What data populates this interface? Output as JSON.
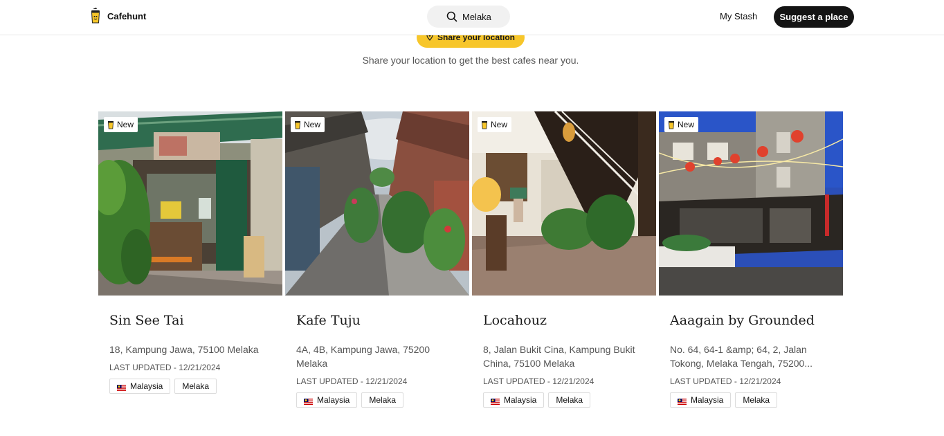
{
  "header": {
    "brand_name": "Cafehunt",
    "search_value": "Melaka",
    "my_stash_label": "My Stash",
    "suggest_label": "Suggest a place"
  },
  "location": {
    "button_label": "Share your location",
    "hint": "Share your location to get the best cafes near you."
  },
  "cafes": [
    {
      "badge": "New",
      "name": "Sin See Tai",
      "address": "18, Kampung Jawa, 75100 Melaka",
      "updated": "LAST UPDATED - 12/21/2024",
      "country": "Malaysia",
      "city": "Melaka"
    },
    {
      "badge": "New",
      "name": "Kafe Tuju",
      "address": "4A, 4B, Kampung Jawa, 75200 Melaka",
      "updated": "LAST UPDATED - 12/21/2024",
      "country": "Malaysia",
      "city": "Melaka"
    },
    {
      "badge": "New",
      "name": "Locahouz",
      "address": "8, Jalan Bukit Cina, Kampung Bukit China, 75100 Melaka",
      "updated": "LAST UPDATED - 12/21/2024",
      "country": "Malaysia",
      "city": "Melaka"
    },
    {
      "badge": "New",
      "name": "Aaagain by Grounded",
      "address": "No. 64, 64-1 &amp; 64, 2, Jalan Tokong, Melaka Tengah, 75200...",
      "updated": "LAST UPDATED - 12/21/2024",
      "country": "Malaysia",
      "city": "Melaka"
    }
  ],
  "colors": {
    "accent_yellow": "#f7c62a",
    "button_dark": "#141414"
  },
  "icons": {
    "brand": "coffee-cup-icon",
    "search": "search-icon",
    "location": "map-pin-icon",
    "badge": "coffee-cup-icon",
    "flag": "malaysia-flag-icon"
  }
}
